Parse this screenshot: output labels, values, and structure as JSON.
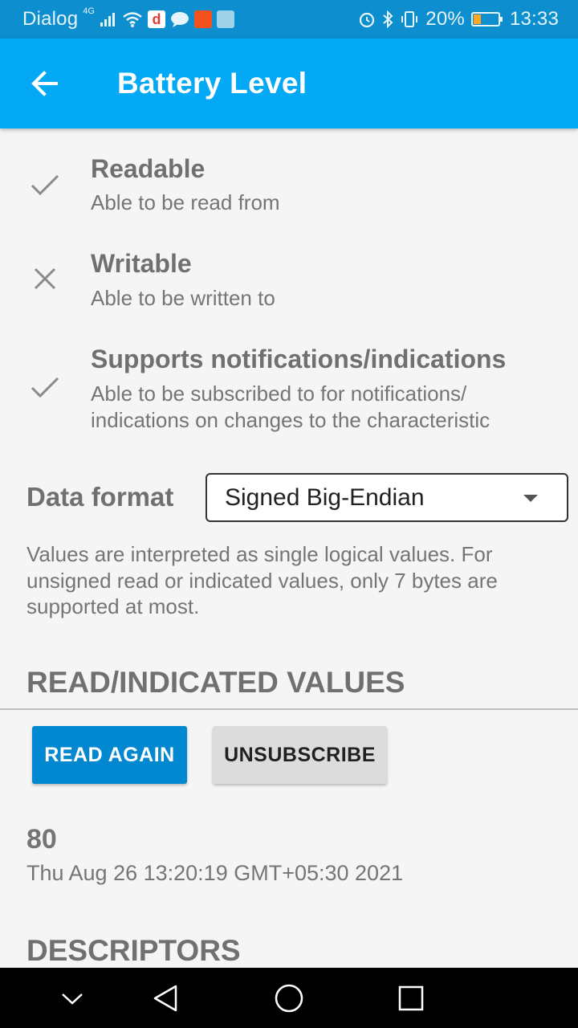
{
  "status_bar": {
    "carrier": "Dialog",
    "network": "4G",
    "battery_percent": "20%",
    "time": "13:33",
    "icons_left": [
      "signal-icon",
      "wifi-icon",
      "daraz-app-icon",
      "message-icon",
      "shopping-app-icon",
      "gallery-app-icon"
    ],
    "icons_right": [
      "alarm-icon",
      "bluetooth-icon",
      "vibrate-icon",
      "battery-icon"
    ]
  },
  "app_bar": {
    "title": "Battery Level",
    "back_icon": "arrow-back-icon",
    "color": "#03a9f4"
  },
  "properties": [
    {
      "icon": "check-icon",
      "title": "Readable",
      "description": "Able to be read from"
    },
    {
      "icon": "close-icon",
      "title": "Writable",
      "description": "Able to be written to"
    },
    {
      "icon": "check-icon",
      "title": "Supports notifications/indications",
      "description": "Able to be subscribed to for notifications/ indications on changes to the characteristic"
    }
  ],
  "data_format": {
    "label": "Data format",
    "selected": "Signed Big-Endian",
    "help": "Values are interpreted as single logical values. For unsigned read or indicated values, only 7 bytes are supported at most."
  },
  "read_section": {
    "header": "READ/INDICATED VALUES",
    "read_again_label": "READ AGAIN",
    "unsubscribe_label": "UNSUBSCRIBE",
    "value": "80",
    "timestamp": "Thu Aug 26 13:20:19 GMT+05:30 2021"
  },
  "descriptors_section": {
    "header": "DESCRIPTORS"
  },
  "colors": {
    "primary": "#03a9f4",
    "button_primary": "#0288d1",
    "status_bar": "#0d8fcf"
  }
}
